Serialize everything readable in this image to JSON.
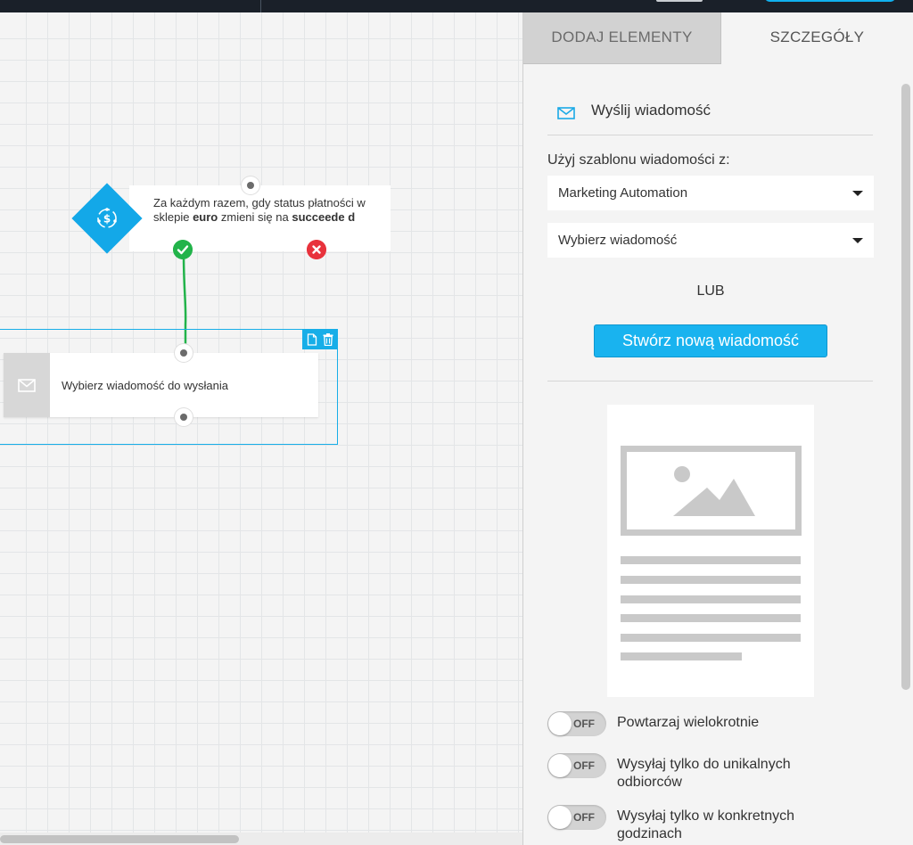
{
  "topbar": {},
  "trigger": {
    "text_1": "Za każdym razem, gdy status płatności w sklepie ",
    "store": "euro",
    "text_2": " zmieni się na ",
    "status": "succeede d"
  },
  "action": {
    "label": "Wybierz wiadomość do wysłania"
  },
  "tabs": {
    "add": "DODAJ ELEMENTY",
    "details": "SZCZEGÓŁY"
  },
  "panel": {
    "title": "Wyślij wiadomość",
    "use_template_label": "Użyj szablonu wiadomości z:",
    "template_source": "Marketing Automation",
    "message_select": "Wybierz wiadomość",
    "or": "LUB",
    "create_button": "Stwórz nową wiadomość",
    "toggles": [
      {
        "label": "Powtarzaj wielokrotnie",
        "state": "OFF"
      },
      {
        "label": "Wysyłaj tylko do unikalnych odbiorców",
        "state": "OFF"
      },
      {
        "label": "Wysyłaj tylko w konkretnych godzinach",
        "state": "OFF"
      }
    ]
  },
  "colors": {
    "accent": "#19b3ef",
    "success": "#22b34a",
    "danger": "#e8323c",
    "topbar": "#1a2029"
  }
}
